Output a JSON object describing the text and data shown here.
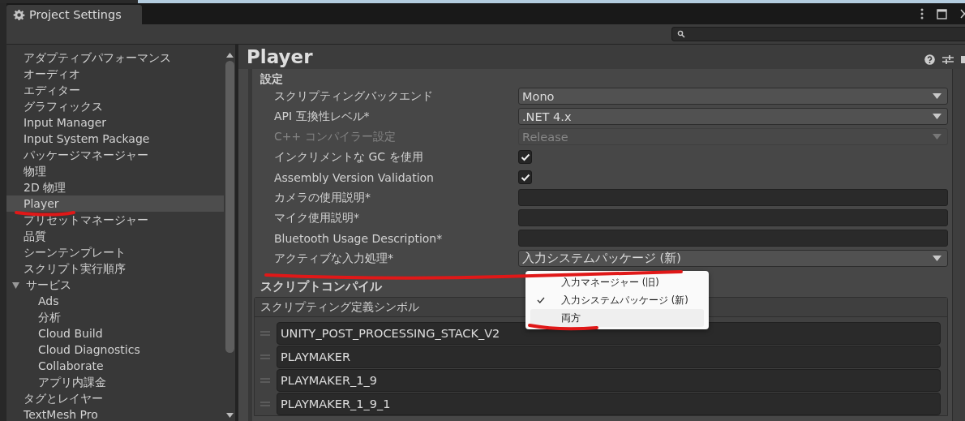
{
  "window": {
    "title": "Project Settings"
  },
  "sidebar": {
    "items": [
      {
        "label": "アダプティブパフォーマンス",
        "selected": false
      },
      {
        "label": "オーディオ",
        "selected": false
      },
      {
        "label": "エディター",
        "selected": false
      },
      {
        "label": "グラフィックス",
        "selected": false
      },
      {
        "label": "Input Manager",
        "selected": false
      },
      {
        "label": "Input System Package",
        "selected": false
      },
      {
        "label": "パッケージマネージャー",
        "selected": false
      },
      {
        "label": "物理",
        "selected": false
      },
      {
        "label": "2D 物理",
        "selected": false
      },
      {
        "label": "Player",
        "selected": true
      },
      {
        "label": "プリセットマネージャー",
        "selected": false
      },
      {
        "label": "品質",
        "selected": false
      },
      {
        "label": "シーンテンプレート",
        "selected": false
      },
      {
        "label": "スクリプト実行順序",
        "selected": false
      },
      {
        "label": "サービス",
        "selected": false,
        "expanded": true,
        "children": [
          {
            "label": "Ads",
            "selected": false
          },
          {
            "label": "分析",
            "selected": false
          },
          {
            "label": "Cloud Build",
            "selected": false
          },
          {
            "label": "Cloud Diagnostics",
            "selected": false
          },
          {
            "label": "Collaborate",
            "selected": false
          },
          {
            "label": "アプリ内課金",
            "selected": false
          }
        ]
      },
      {
        "label": "タグとレイヤー",
        "selected": false
      },
      {
        "label": "TextMesh Pro",
        "selected": false
      }
    ]
  },
  "page": {
    "title": "Player",
    "section": "設定",
    "rows": [
      {
        "kind": "dropdown",
        "label": "スクリプティングバックエンド",
        "value": "Mono",
        "disabled": false
      },
      {
        "kind": "dropdown",
        "label": "API 互換性レベル*",
        "value": ".NET 4.x",
        "disabled": false
      },
      {
        "kind": "dropdown",
        "label": "C++ コンパイラー設定",
        "value": "Release",
        "disabled": true
      },
      {
        "kind": "checkbox",
        "label": "インクリメントな GC を使用",
        "checked": true
      },
      {
        "kind": "checkbox",
        "label": "Assembly Version Validation",
        "checked": true
      },
      {
        "kind": "text",
        "label": "カメラの使用説明*"
      },
      {
        "kind": "text",
        "label": "マイク使用説明*"
      },
      {
        "kind": "text",
        "label": "Bluetooth Usage Description*"
      },
      {
        "kind": "dropdown",
        "label": "アクティブな入力処理*",
        "value": "入力システムパッケージ (新)",
        "disabled": false
      }
    ]
  },
  "popup": {
    "items": [
      {
        "label": "入力マネージャー (旧)",
        "checked": false,
        "highlighted": false
      },
      {
        "label": "入力システムパッケージ (新)",
        "checked": true,
        "highlighted": false
      },
      {
        "label": "両方",
        "checked": false,
        "highlighted": true
      }
    ]
  },
  "script_compile": {
    "title": "スクリプトコンパイル",
    "list_header": "スクリプティング定義シンボル",
    "symbols": [
      "UNITY_POST_PROCESSING_STACK_V2",
      "PLAYMAKER",
      "PLAYMAKER_1_9",
      "PLAYMAKER_1_9_1"
    ]
  },
  "annotations": [
    {
      "kind": "underline"
    },
    {
      "kind": "underline"
    },
    {
      "kind": "underline"
    }
  ]
}
